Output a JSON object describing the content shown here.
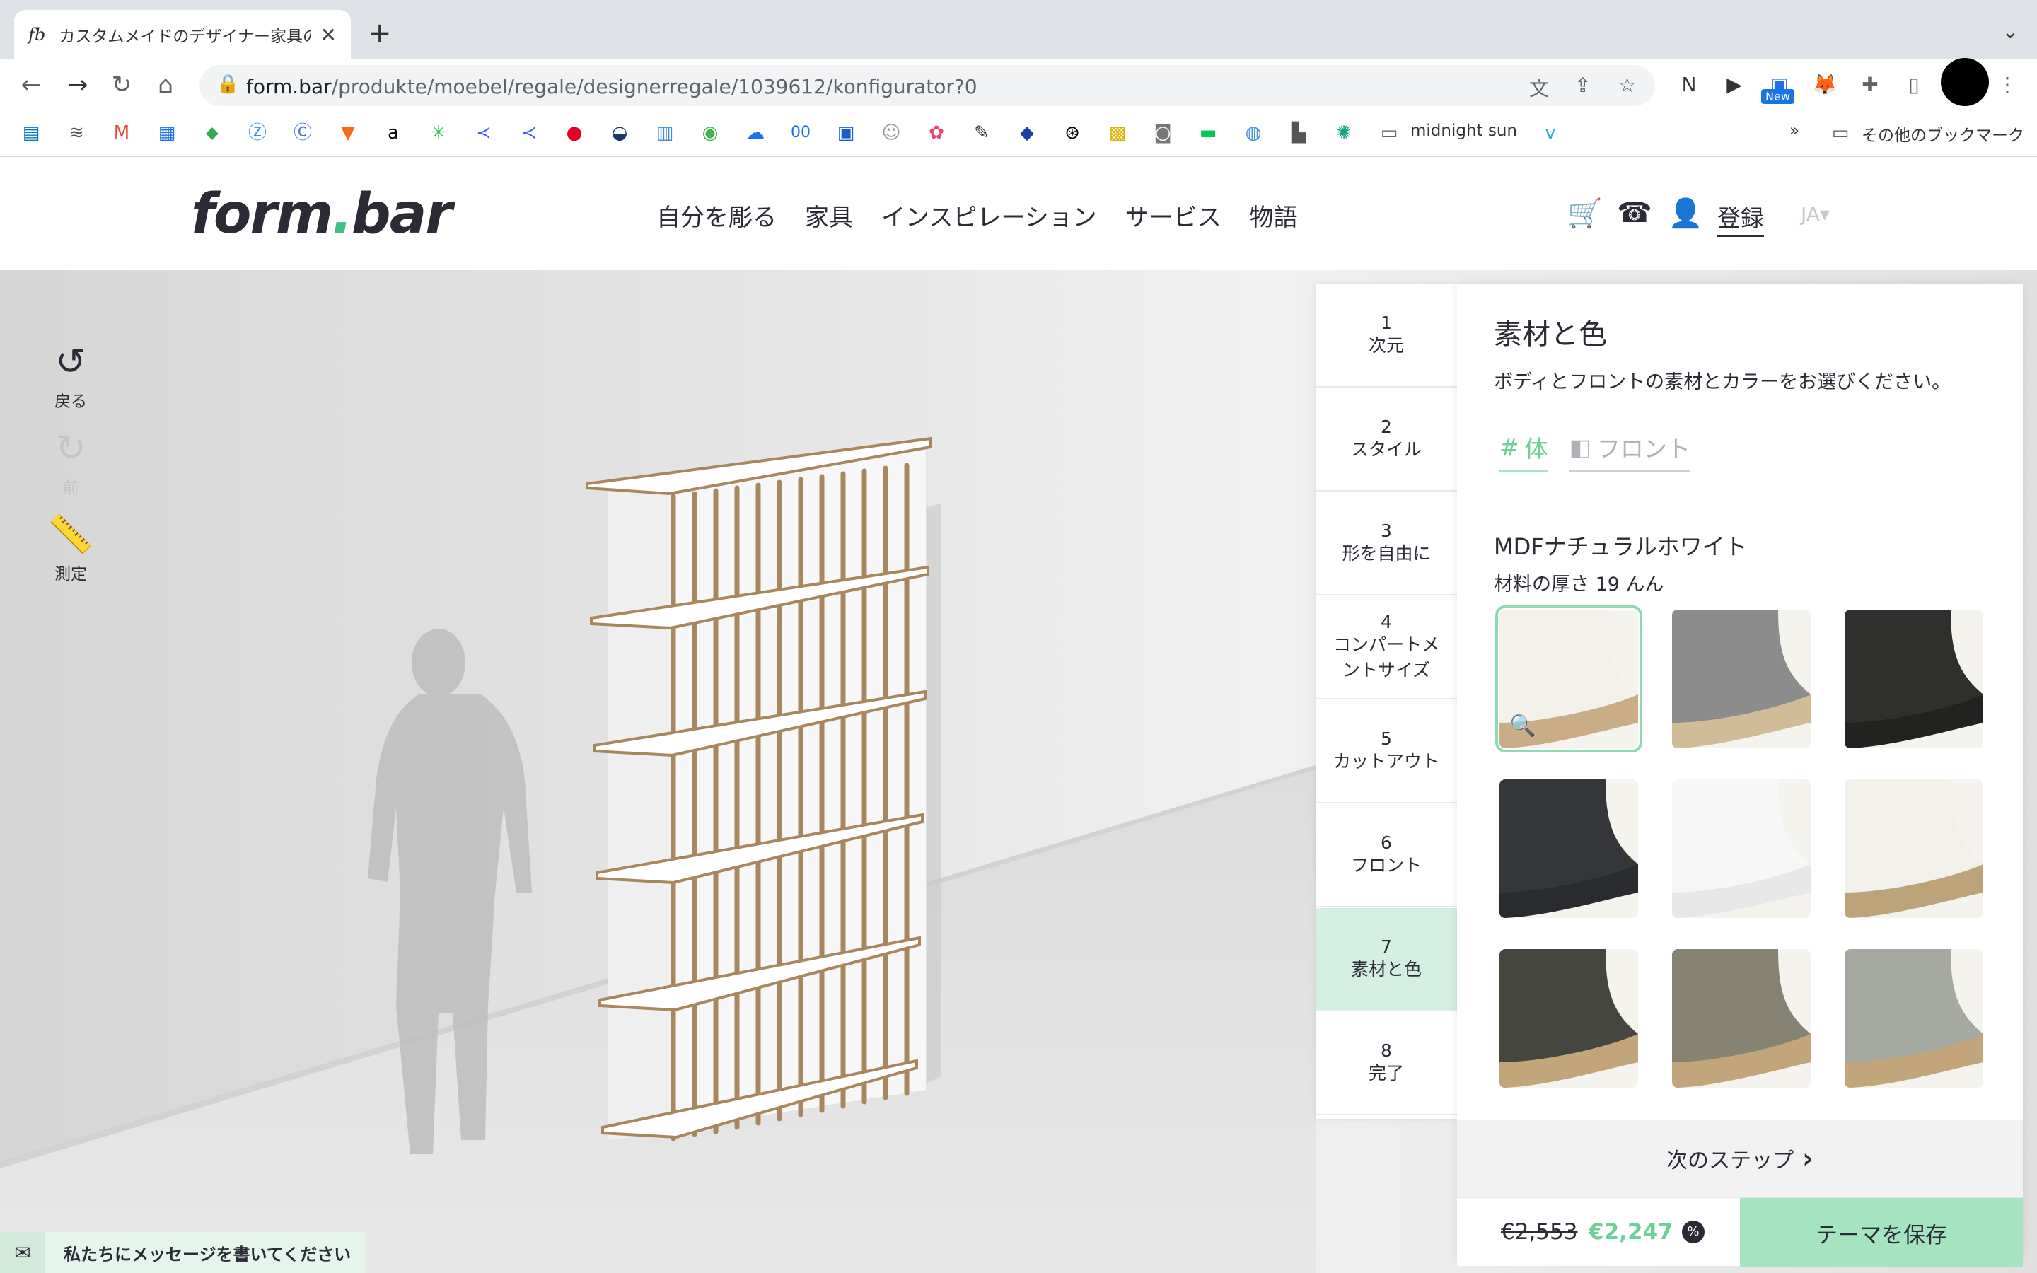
{
  "browser": {
    "tab_title": "カスタムメイドのデザイナー家具の",
    "tab_favicon": "fb",
    "url_domain": "form.bar",
    "url_path": "/produkte/moebel/regale/designerregale/1039612/konfigurator?0",
    "new_badge": "New",
    "bookmarks_overflow": "»",
    "bookmark_folder_1": "midnight sun",
    "bookmark_folder_2": "その他のブックマーク"
  },
  "site": {
    "logo_left": "form",
    "logo_dot": ".",
    "logo_right": "bar",
    "nav": [
      "自分を彫る",
      "家具",
      "インスピレーション",
      "サービス",
      "物語"
    ],
    "register": "登録",
    "language": "JA"
  },
  "tools": {
    "undo": "戻る",
    "redo": "前",
    "measure": "測定"
  },
  "steps": [
    {
      "num": "1",
      "label": "次元"
    },
    {
      "num": "2",
      "label": "スタイル"
    },
    {
      "num": "3",
      "label": "形を自由に"
    },
    {
      "num": "4",
      "label": "コンパートメントサイズ"
    },
    {
      "num": "5",
      "label": "カットアウト"
    },
    {
      "num": "6",
      "label": "フロント"
    },
    {
      "num": "7",
      "label": "素材と色"
    },
    {
      "num": "8",
      "label": "完了"
    }
  ],
  "active_step": 7,
  "panel": {
    "title": "素材と色",
    "description": "ボディとフロントの素材とカラーをお選びください。",
    "tab_body": "体",
    "tab_front": "フロント",
    "material_name": "MDFナチュラルホワイト",
    "material_thickness": "材料の厚さ 19 んん",
    "swatches": [
      {
        "name": "mdf-natural-white",
        "top": "#f4f1ea",
        "edge": "#c9ad86",
        "selected": true
      },
      {
        "name": "grey-linoleum",
        "top": "#8c8c8c",
        "edge": "#d2bc98",
        "selected": false
      },
      {
        "name": "black-mdf",
        "top": "#2f302e",
        "edge": "#222220",
        "selected": false
      },
      {
        "name": "anthracite",
        "top": "#34363a",
        "edge": "#2a2b2e",
        "selected": false
      },
      {
        "name": "white-lacquer",
        "top": "#f7f7f7",
        "edge": "#e8e8e8",
        "selected": false
      },
      {
        "name": "white-plywood",
        "top": "#f2f0ea",
        "edge": "#bca37a",
        "selected": false
      },
      {
        "name": "dark-linoleum-plywood",
        "top": "#464641",
        "edge": "#c2a57a",
        "selected": false
      },
      {
        "name": "olive-linoleum-plywood",
        "top": "#878373",
        "edge": "#c2a57a",
        "selected": false
      },
      {
        "name": "sage-linoleum-plywood",
        "top": "#a6a8a2",
        "edge": "#c2a57a",
        "selected": false
      }
    ],
    "next_step": "次のステップ",
    "old_price": "€2,553",
    "new_price": "€2,247",
    "discount_icon": "%",
    "save_button": "テーマを保存"
  },
  "chat": {
    "label": "私たちにメッセージを書いてください"
  },
  "colors": {
    "accent": "#6fcf97",
    "accent_light": "#a6e3c0",
    "active_step_bg": "#d3efe2",
    "text": "#2b2b36"
  }
}
